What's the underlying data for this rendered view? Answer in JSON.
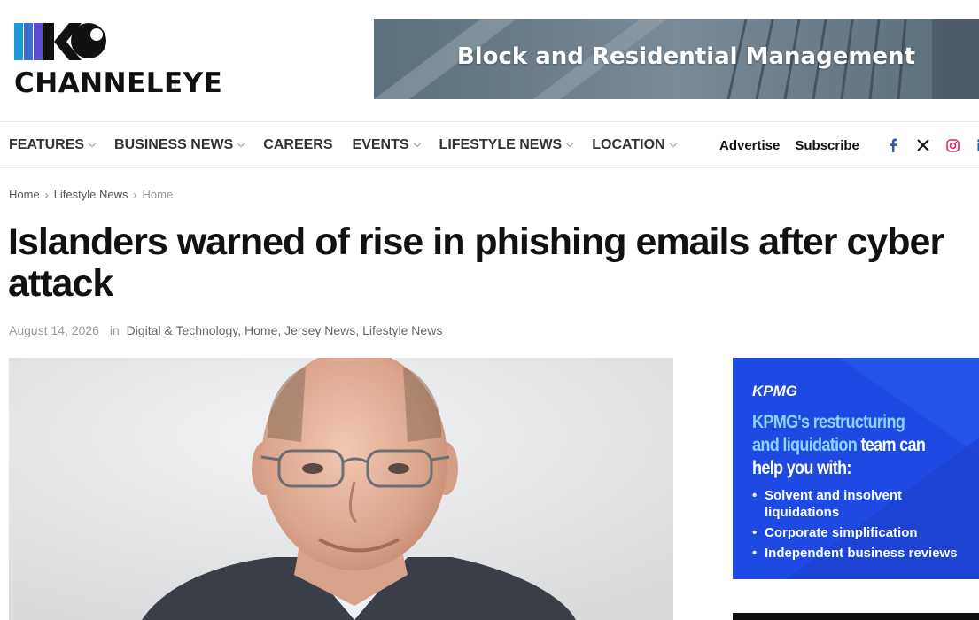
{
  "header": {
    "logo_text": "CHANNELEYE",
    "banner_text": "Block and Residential Management"
  },
  "nav": {
    "items": [
      {
        "label": "FEATURES",
        "dropdown": true
      },
      {
        "label": "BUSINESS NEWS",
        "dropdown": true
      },
      {
        "label": "CAREERS",
        "dropdown": false
      },
      {
        "label": "EVENTS",
        "dropdown": true
      },
      {
        "label": "LIFESTYLE NEWS",
        "dropdown": true
      },
      {
        "label": "LOCATION",
        "dropdown": true
      }
    ],
    "advertise": "Advertise",
    "subscribe": "Subscribe",
    "social_icons": [
      "facebook-icon",
      "x-icon",
      "instagram-icon",
      "linkedin-icon"
    ]
  },
  "breadcrumb": {
    "items": [
      "Home",
      "Lifestyle News",
      "Home"
    ]
  },
  "article": {
    "title": "Islanders warned of rise in phishing emails after cyber attack",
    "date": "August 14, 2026",
    "in_label": "in",
    "categories": [
      "Digital & Technology,",
      "Home,",
      "Jersey News,",
      "Lifestyle News"
    ]
  },
  "ad": {
    "brand": "KPMG",
    "headline_1": "KPMG's restructuring and liquidation",
    "headline_2": "team can help you with:",
    "items": [
      "Solvent and insolvent liquidations",
      "Corporate simplification",
      "Independent business reviews"
    ]
  },
  "colors": {
    "ad_background": "#1e49e2",
    "ad_highlight": "#8fd3ff",
    "logo_accent": "#1a9bd7"
  }
}
